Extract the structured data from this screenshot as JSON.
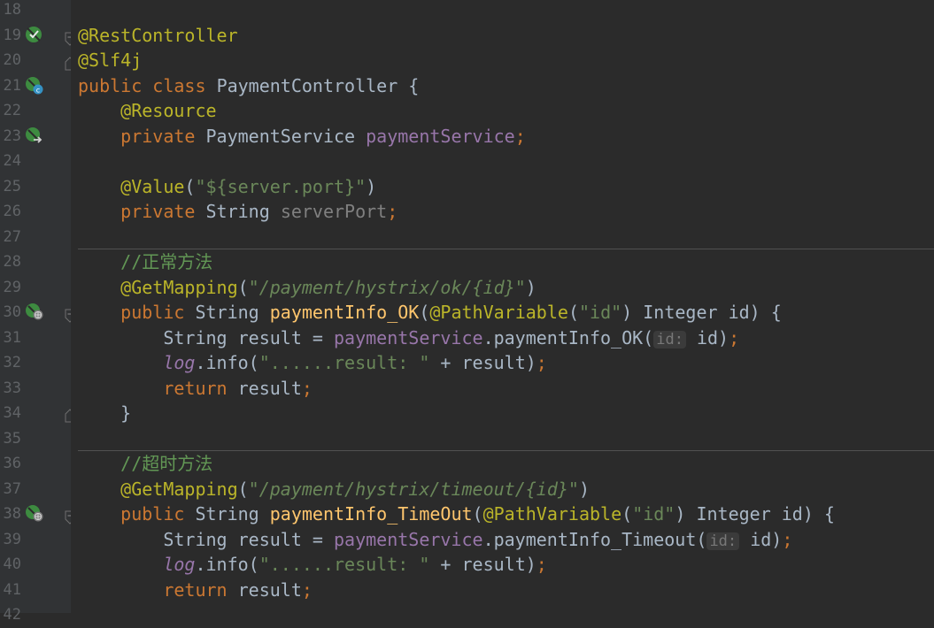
{
  "gutter": {
    "line_numbers": [
      "18",
      "19",
      "20",
      "21",
      "22",
      "23",
      "24",
      "25",
      "26",
      "27",
      "28",
      "29",
      "30",
      "31",
      "32",
      "33",
      "34",
      "35",
      "36",
      "37",
      "38",
      "39",
      "40",
      "41",
      "42"
    ]
  },
  "icons": {
    "line19": "spring-bean-check-icon",
    "line21": "spring-bean-class-icon",
    "line23": "spring-bean-inject-icon",
    "line30": "spring-web-endpoint-icon",
    "line38": "spring-web-endpoint-icon"
  },
  "code": {
    "l19": {
      "ann": "@RestController"
    },
    "l20": {
      "ann": "@Slf4j"
    },
    "l21": {
      "kw1": "public",
      "kw2": "class",
      "name": "PaymentController",
      "brace": " {"
    },
    "l22": {
      "ann": "@Resource"
    },
    "l23": {
      "kw": "private",
      "type": "PaymentService",
      "field": "paymentService",
      "semi": ";"
    },
    "l25": {
      "ann": "@Value",
      "p1": "(",
      "str": "\"${server.port}\"",
      "p2": ")"
    },
    "l26": {
      "kw": "private",
      "type": "String",
      "field": "serverPort",
      "semi": ";"
    },
    "l28": {
      "comment": "//正常方法"
    },
    "l29": {
      "ann": "@GetMapping",
      "p1": "(",
      "str": "\"/payment/hystrix/ok/{id}\"",
      "p2": ")"
    },
    "l30": {
      "kw": "public",
      "type": "String",
      "meth": "paymentInfo_OK",
      "p1": "(",
      "ann": "@PathVariable",
      "p2": "(",
      "str": "\"id\"",
      "p3": ") Integer id) {"
    },
    "l31": {
      "t1": "String result = ",
      "field": "paymentService",
      "t2": ".paymentInfo_OK(",
      "hint": "id:",
      "t3": " id)",
      "semi": ";"
    },
    "l32": {
      "log": "log",
      "t1": ".info(",
      "str": "\"......result: \"",
      "t2": " + result)",
      "semi": ";"
    },
    "l33": {
      "kw": "return",
      "t1": " result",
      "semi": ";"
    },
    "l34": {
      "t1": "}"
    },
    "l36": {
      "comment": "//超时方法"
    },
    "l37": {
      "ann": "@GetMapping",
      "p1": "(",
      "str": "\"/payment/hystrix/timeout/{id}\"",
      "p2": ")"
    },
    "l38": {
      "kw": "public",
      "type": "String",
      "meth": "paymentInfo_TimeOut",
      "p1": "(",
      "ann": "@PathVariable",
      "p2": "(",
      "str": "\"id\"",
      "p3": ") Integer id) {"
    },
    "l39": {
      "t1": "String result = ",
      "field": "paymentService",
      "t2": ".paymentInfo_Timeout(",
      "hint": "id:",
      "t3": " id)",
      "semi": ";"
    },
    "l40": {
      "log": "log",
      "t1": ".info(",
      "str": "\"......result: \"",
      "t2": " + result)",
      "semi": ";"
    },
    "l41": {
      "kw": "return",
      "t1": " result",
      "semi": ";"
    }
  },
  "colors": {
    "background": "#2b2b2b",
    "gutter": "#313335",
    "keyword": "#cc7832",
    "annotation": "#bbb529",
    "string": "#6a8759",
    "field": "#9876aa",
    "method": "#ffc66d",
    "comment": "#629755",
    "text": "#a9b7c6",
    "spring_icon": "#3d8b40"
  }
}
